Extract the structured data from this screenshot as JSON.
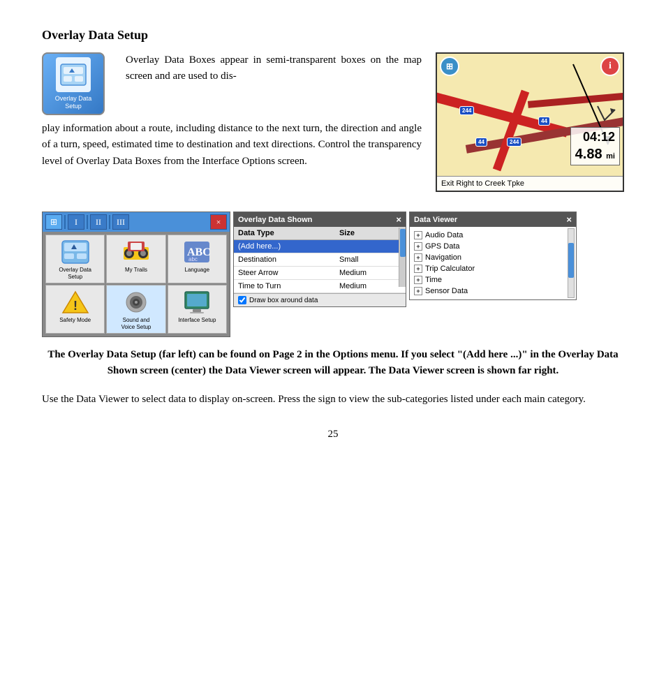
{
  "page": {
    "title": "Overlay Data Setup",
    "icon_label": "Overlay Data\nSetup",
    "description_inline": "Overlay Data Boxes appear in semi-transparent boxes on the map screen and are used to dis-",
    "description_full": "play information about a route, including distance to the next turn, the direction and angle of a turn, speed, estimated time to destination and text directions. Control the transparency level of Overlay Data Boxes from the Interface Options screen.",
    "map": {
      "time": "04:12",
      "distance": "4.88",
      "distance_unit": "mi",
      "direction": "Exit Right to Creek Tpke"
    },
    "toolbar": {
      "items": [
        "⊞",
        "I",
        "II",
        "III"
      ],
      "close": "×"
    },
    "options_grid": [
      {
        "label": "Overlay Data\nSetup",
        "icon": "🗺"
      },
      {
        "label": "My Trails",
        "icon": "🚗"
      },
      {
        "label": "Language",
        "icon": "🌐"
      },
      {
        "label": "Safety Mode",
        "icon": "⚠"
      },
      {
        "label": "Sound and\nVoice Setup",
        "icon": "🔊"
      },
      {
        "label": "Interface Setup",
        "icon": "🖥"
      }
    ],
    "overlay_panel": {
      "title": "Overlay Data Shown",
      "close": "×",
      "columns": [
        "Data Type",
        "Size"
      ],
      "rows": [
        {
          "type": "(Add here...)",
          "size": "",
          "selected": true
        },
        {
          "type": "Destination",
          "size": "Small"
        },
        {
          "type": "Steer Arrow",
          "size": "Medium"
        },
        {
          "type": "Time to Turn",
          "size": "Medium"
        }
      ],
      "footer": "Draw box around data"
    },
    "viewer_panel": {
      "title": "Data Viewer",
      "close": "×",
      "items": [
        "Audio Data",
        "GPS Data",
        "Navigation",
        "Trip Calculator",
        "Time",
        "Sensor Data"
      ]
    },
    "caption": "The Overlay Data Setup (far left) can be found on Page 2 in the Options menu. If you select \"(Add here ...)\" in the Overlay Data Shown screen (center) the Data Viewer screen will appear. The Data Viewer screen is shown far right.",
    "body_text": "Use the Data Viewer to select data to display on-screen. Press the sign to view the sub-categories listed under each main category.",
    "page_number": "25"
  }
}
